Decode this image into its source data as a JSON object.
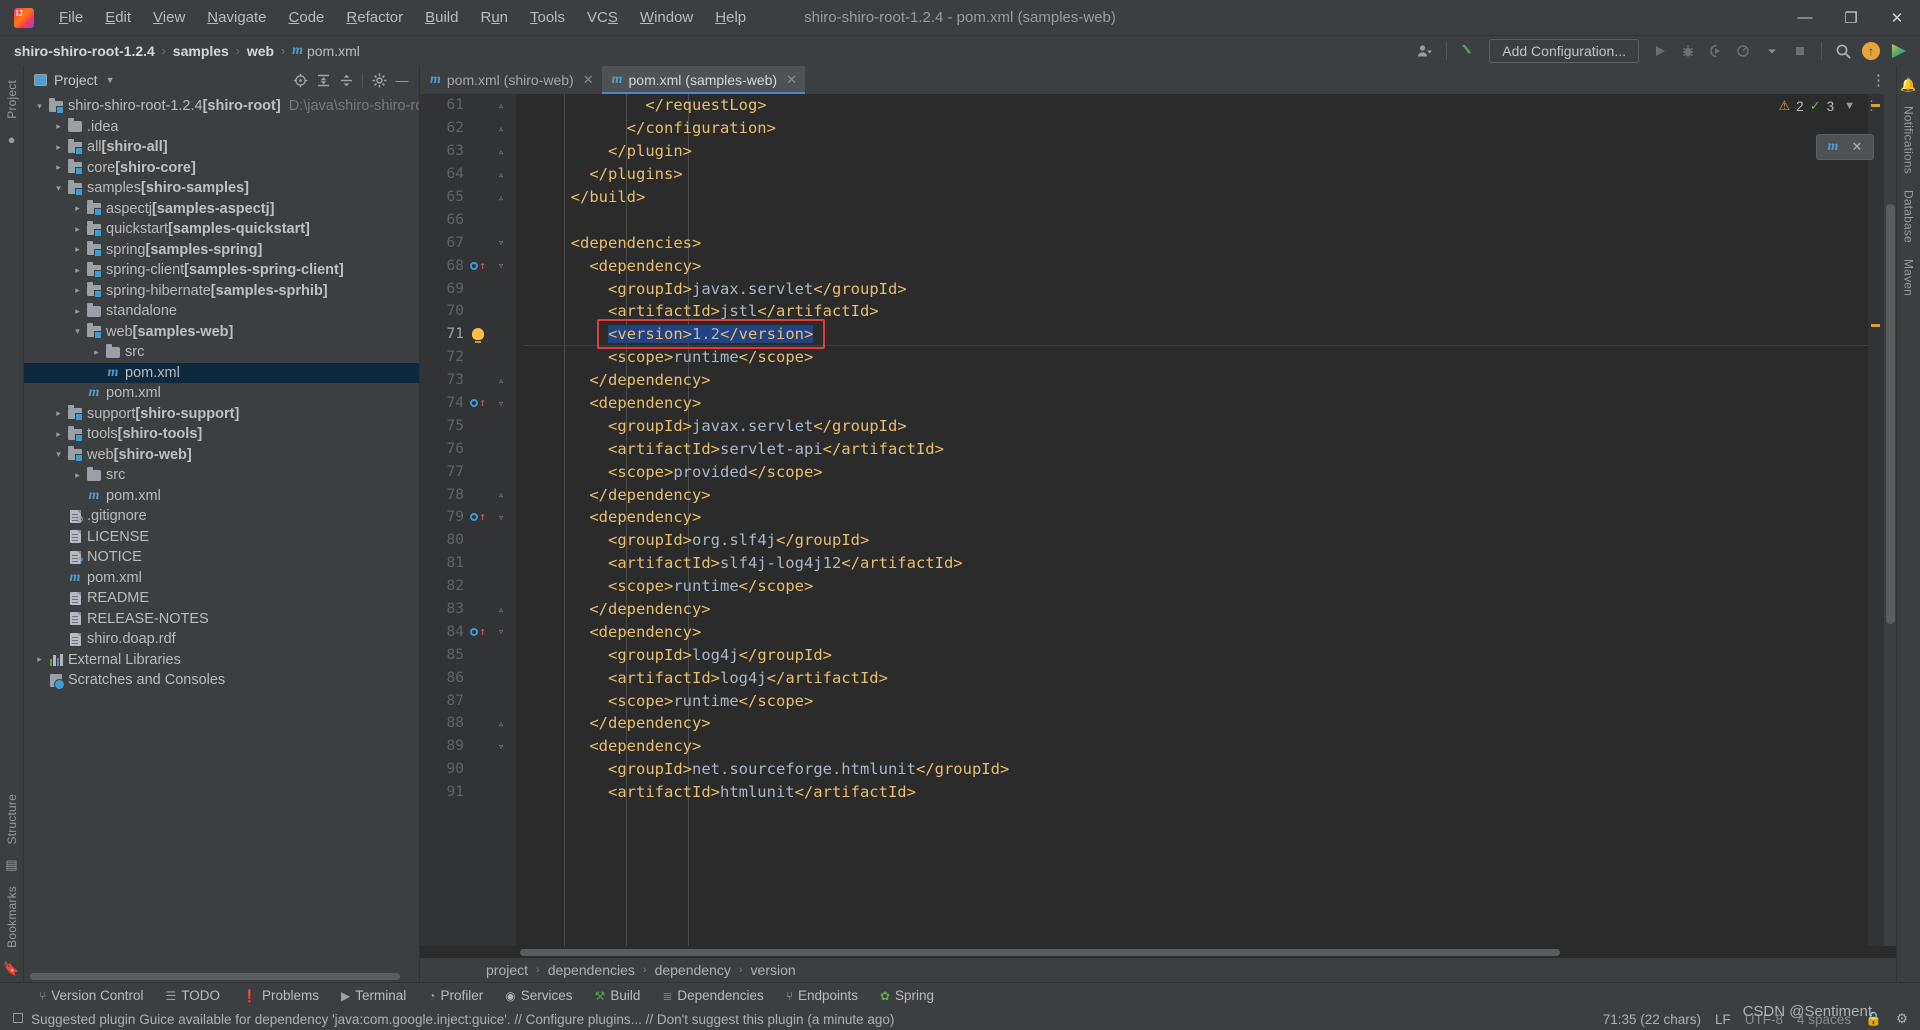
{
  "window": {
    "title": "shiro-shiro-root-1.2.4 - pom.xml (samples-web)",
    "logo_text": "IJ",
    "minimize": "—",
    "maximize": "❐",
    "close": "✕"
  },
  "menubar": [
    {
      "label": "File",
      "mnemonic": "F"
    },
    {
      "label": "Edit",
      "mnemonic": "E"
    },
    {
      "label": "View",
      "mnemonic": "V"
    },
    {
      "label": "Navigate",
      "mnemonic": "N"
    },
    {
      "label": "Code",
      "mnemonic": "C"
    },
    {
      "label": "Refactor",
      "mnemonic": "R"
    },
    {
      "label": "Build",
      "mnemonic": "B"
    },
    {
      "label": "Run",
      "mnemonic": "u"
    },
    {
      "label": "Tools",
      "mnemonic": "T"
    },
    {
      "label": "VCS",
      "mnemonic": "S"
    },
    {
      "label": "Window",
      "mnemonic": "W"
    },
    {
      "label": "Help",
      "mnemonic": "H"
    }
  ],
  "navbar": {
    "crumbs": [
      "shiro-shiro-root-1.2.4",
      "samples",
      "web",
      "pom.xml"
    ],
    "separator": "›",
    "add_configuration": "Add Configuration...",
    "maven_glyph": "m"
  },
  "left_strip": {
    "project_tab": "Project",
    "structure_tab": "Structure",
    "bookmarks_tab": "Bookmarks"
  },
  "right_strip": {
    "notifications_tab": "Notifications",
    "database_tab": "Database",
    "maven_tab": "Maven"
  },
  "project_panel": {
    "title": "Project",
    "tree": [
      {
        "depth": 0,
        "arrow": "open",
        "icon": "module",
        "label": "shiro-shiro-root-1.2.4",
        "module": "[shiro-root]",
        "hint": "D:\\java\\shiro-shiro-root",
        "selected": false
      },
      {
        "depth": 1,
        "arrow": "closed",
        "icon": "folder",
        "label": ".idea",
        "module": "",
        "hint": "",
        "selected": false
      },
      {
        "depth": 1,
        "arrow": "closed",
        "icon": "module",
        "label": "all",
        "module": "[shiro-all]",
        "hint": "",
        "selected": false
      },
      {
        "depth": 1,
        "arrow": "closed",
        "icon": "module",
        "label": "core",
        "module": "[shiro-core]",
        "hint": "",
        "selected": false
      },
      {
        "depth": 1,
        "arrow": "open",
        "icon": "module",
        "label": "samples",
        "module": "[shiro-samples]",
        "hint": "",
        "selected": false
      },
      {
        "depth": 2,
        "arrow": "closed",
        "icon": "module",
        "label": "aspectj",
        "module": "[samples-aspectj]",
        "hint": "",
        "selected": false
      },
      {
        "depth": 2,
        "arrow": "closed",
        "icon": "module",
        "label": "quickstart",
        "module": "[samples-quickstart]",
        "hint": "",
        "selected": false
      },
      {
        "depth": 2,
        "arrow": "closed",
        "icon": "module",
        "label": "spring",
        "module": "[samples-spring]",
        "hint": "",
        "selected": false
      },
      {
        "depth": 2,
        "arrow": "closed",
        "icon": "module",
        "label": "spring-client",
        "module": "[samples-spring-client]",
        "hint": "",
        "selected": false
      },
      {
        "depth": 2,
        "arrow": "closed",
        "icon": "module",
        "label": "spring-hibernate",
        "module": "[samples-sprhib]",
        "hint": "",
        "selected": false
      },
      {
        "depth": 2,
        "arrow": "closed",
        "icon": "folder",
        "label": "standalone",
        "module": "",
        "hint": "",
        "selected": false
      },
      {
        "depth": 2,
        "arrow": "open",
        "icon": "module",
        "label": "web",
        "module": "[samples-web]",
        "hint": "",
        "selected": false
      },
      {
        "depth": 3,
        "arrow": "closed",
        "icon": "folder",
        "label": "src",
        "module": "",
        "hint": "",
        "selected": false
      },
      {
        "depth": 3,
        "arrow": "none",
        "icon": "maven",
        "label": "pom.xml",
        "module": "",
        "hint": "",
        "selected": true
      },
      {
        "depth": 2,
        "arrow": "none",
        "icon": "maven",
        "label": "pom.xml",
        "module": "",
        "hint": "",
        "selected": false
      },
      {
        "depth": 1,
        "arrow": "closed",
        "icon": "module",
        "label": "support",
        "module": "[shiro-support]",
        "hint": "",
        "selected": false
      },
      {
        "depth": 1,
        "arrow": "closed",
        "icon": "module",
        "label": "tools",
        "module": "[shiro-tools]",
        "hint": "",
        "selected": false
      },
      {
        "depth": 1,
        "arrow": "open",
        "icon": "module",
        "label": "web",
        "module": "[shiro-web]",
        "hint": "",
        "selected": false
      },
      {
        "depth": 2,
        "arrow": "closed",
        "icon": "folder",
        "label": "src",
        "module": "",
        "hint": "",
        "selected": false
      },
      {
        "depth": 2,
        "arrow": "none",
        "icon": "maven",
        "label": "pom.xml",
        "module": "",
        "hint": "",
        "selected": false
      },
      {
        "depth": 1,
        "arrow": "none",
        "icon": "gitignore",
        "label": ".gitignore",
        "module": "",
        "hint": "",
        "selected": false
      },
      {
        "depth": 1,
        "arrow": "none",
        "icon": "file",
        "label": "LICENSE",
        "module": "",
        "hint": "",
        "selected": false
      },
      {
        "depth": 1,
        "arrow": "none",
        "icon": "unknown",
        "label": "NOTICE",
        "module": "",
        "hint": "",
        "selected": false
      },
      {
        "depth": 1,
        "arrow": "none",
        "icon": "maven",
        "label": "pom.xml",
        "module": "",
        "hint": "",
        "selected": false
      },
      {
        "depth": 1,
        "arrow": "none",
        "icon": "file",
        "label": "README",
        "module": "",
        "hint": "",
        "selected": false
      },
      {
        "depth": 1,
        "arrow": "none",
        "icon": "file",
        "label": "RELEASE-NOTES",
        "module": "",
        "hint": "",
        "selected": false
      },
      {
        "depth": 1,
        "arrow": "none",
        "icon": "file",
        "label": "shiro.doap.rdf",
        "module": "",
        "hint": "",
        "selected": false
      },
      {
        "depth": 0,
        "arrow": "closed",
        "icon": "lib",
        "label": "External Libraries",
        "module": "",
        "hint": "",
        "selected": false
      },
      {
        "depth": 0,
        "arrow": "none",
        "icon": "scratch",
        "label": "Scratches and Consoles",
        "module": "",
        "hint": "",
        "selected": false
      }
    ]
  },
  "editor": {
    "tabs": [
      {
        "label": "pom.xml (shiro-web)",
        "active": false
      },
      {
        "label": "pom.xml (samples-web)",
        "active": true
      }
    ],
    "inspection": {
      "warnings": "2",
      "checks": "3"
    },
    "lines": [
      {
        "num": 61,
        "indent": 13,
        "text": "</requestLog>",
        "fold": "end",
        "mark": "",
        "type": "tag"
      },
      {
        "num": 62,
        "indent": 11,
        "text": "</configuration>",
        "fold": "end",
        "mark": "",
        "type": "tag"
      },
      {
        "num": 63,
        "indent": 9,
        "text": "</plugin>",
        "fold": "end",
        "mark": "",
        "type": "tag"
      },
      {
        "num": 64,
        "indent": 7,
        "text": "</plugins>",
        "fold": "end",
        "mark": "",
        "type": "tag"
      },
      {
        "num": 65,
        "indent": 5,
        "text": "</build>",
        "fold": "end",
        "mark": "",
        "type": "tag"
      },
      {
        "num": 66,
        "indent": 0,
        "text": "",
        "fold": "",
        "mark": "",
        "type": "tag"
      },
      {
        "num": 67,
        "indent": 5,
        "text": "<dependencies>",
        "fold": "start",
        "mark": "",
        "type": "tag"
      },
      {
        "num": 68,
        "indent": 7,
        "text": "<dependency>",
        "fold": "start",
        "mark": "run",
        "type": "tag"
      },
      {
        "num": 69,
        "indent": 9,
        "text": "<groupId>javax.servlet</groupId>",
        "fold": "",
        "mark": "",
        "type": "mixed"
      },
      {
        "num": 70,
        "indent": 9,
        "text": "<artifactId>jstl</artifactId>",
        "fold": "",
        "mark": "",
        "type": "mixed"
      },
      {
        "num": 71,
        "indent": 9,
        "text": "<version>1.2</version>",
        "fold": "",
        "mark": "bulb",
        "type": "mixed",
        "highlight": true,
        "annotated": true
      },
      {
        "num": 72,
        "indent": 9,
        "text": "<scope>runtime</scope>",
        "fold": "",
        "mark": "",
        "type": "mixed"
      },
      {
        "num": 73,
        "indent": 7,
        "text": "</dependency>",
        "fold": "end",
        "mark": "",
        "type": "tag"
      },
      {
        "num": 74,
        "indent": 7,
        "text": "<dependency>",
        "fold": "start",
        "mark": "run",
        "type": "tag"
      },
      {
        "num": 75,
        "indent": 9,
        "text": "<groupId>javax.servlet</groupId>",
        "fold": "",
        "mark": "",
        "type": "mixed"
      },
      {
        "num": 76,
        "indent": 9,
        "text": "<artifactId>servlet-api</artifactId>",
        "fold": "",
        "mark": "",
        "type": "mixed"
      },
      {
        "num": 77,
        "indent": 9,
        "text": "<scope>provided</scope>",
        "fold": "",
        "mark": "",
        "type": "mixed"
      },
      {
        "num": 78,
        "indent": 7,
        "text": "</dependency>",
        "fold": "end",
        "mark": "",
        "type": "tag"
      },
      {
        "num": 79,
        "indent": 7,
        "text": "<dependency>",
        "fold": "start",
        "mark": "run",
        "type": "tag"
      },
      {
        "num": 80,
        "indent": 9,
        "text": "<groupId>org.slf4j</groupId>",
        "fold": "",
        "mark": "",
        "type": "mixed"
      },
      {
        "num": 81,
        "indent": 9,
        "text": "<artifactId>slf4j-log4j12</artifactId>",
        "fold": "",
        "mark": "",
        "type": "mixed"
      },
      {
        "num": 82,
        "indent": 9,
        "text": "<scope>runtime</scope>",
        "fold": "",
        "mark": "",
        "type": "mixed"
      },
      {
        "num": 83,
        "indent": 7,
        "text": "</dependency>",
        "fold": "end",
        "mark": "",
        "type": "tag"
      },
      {
        "num": 84,
        "indent": 7,
        "text": "<dependency>",
        "fold": "start",
        "mark": "run",
        "type": "tag"
      },
      {
        "num": 85,
        "indent": 9,
        "text": "<groupId>log4j</groupId>",
        "fold": "",
        "mark": "",
        "type": "mixed"
      },
      {
        "num": 86,
        "indent": 9,
        "text": "<artifactId>log4j</artifactId>",
        "fold": "",
        "mark": "",
        "type": "mixed"
      },
      {
        "num": 87,
        "indent": 9,
        "text": "<scope>runtime</scope>",
        "fold": "",
        "mark": "",
        "type": "mixed"
      },
      {
        "num": 88,
        "indent": 7,
        "text": "</dependency>",
        "fold": "end",
        "mark": "",
        "type": "tag"
      },
      {
        "num": 89,
        "indent": 7,
        "text": "<dependency>",
        "fold": "start",
        "mark": "",
        "type": "tag"
      },
      {
        "num": 90,
        "indent": 9,
        "text": "<groupId>net.sourceforge.htmlunit</groupId>",
        "fold": "",
        "mark": "",
        "type": "mixed"
      },
      {
        "num": 91,
        "indent": 9,
        "text": "<artifactId>htmlunit</artifactId>",
        "fold": "",
        "mark": "",
        "type": "mixed"
      }
    ],
    "breadcrumbs": [
      "project",
      "dependencies",
      "dependency",
      "version"
    ],
    "breadcrumb_separator": "›"
  },
  "tool_windows": [
    {
      "label": "Version Control",
      "icon": "branch-icon"
    },
    {
      "label": "TODO",
      "icon": "list-icon"
    },
    {
      "label": "Problems",
      "icon": "warning-icon"
    },
    {
      "label": "Terminal",
      "icon": "terminal-icon"
    },
    {
      "label": "Profiler",
      "icon": "gauge-icon"
    },
    {
      "label": "Services",
      "icon": "play-circle-icon"
    },
    {
      "label": "Build",
      "icon": "hammer-icon"
    },
    {
      "label": "Dependencies",
      "icon": "layers-icon"
    },
    {
      "label": "Endpoints",
      "icon": "endpoints-icon"
    },
    {
      "label": "Spring",
      "icon": "leaf-icon"
    }
  ],
  "status_bar": {
    "message": "Suggested plugin Guice available for dependency 'java:com.google.inject:guice'. // Configure plugins... // Don't suggest this plugin (a minute ago)",
    "caret": "71:35 (22 chars)",
    "line_separator": "LF",
    "encoding": "UTF-8",
    "indent": "4 spaces"
  },
  "watermark": "CSDN @Sentiment",
  "colors": {
    "bg_panel": "#3c3f41",
    "bg_editor": "#2b2b2b",
    "bg_gutter": "#313335",
    "accent_blue": "#4a88c7",
    "tag_orange": "#e8bf6a",
    "text_code": "#a9b7c6",
    "selection": "#214283",
    "annotation_red": "#e23b3b",
    "tree_selected": "#0d293e"
  }
}
